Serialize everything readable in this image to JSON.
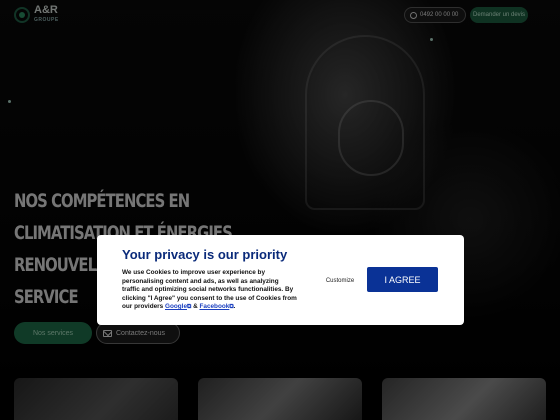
{
  "header": {
    "logo_text": "A&R",
    "logo_subtext": "GROUPE",
    "phone_label": "0492 00 00 00",
    "cta_label": "Demander un devis"
  },
  "hero": {
    "title": "NOS COMPÉTENCES EN CLIMATISATION ET ÉNERGIES RENOUVELABLES À VOTRE SERVICE",
    "primary_button": "Nos services",
    "secondary_button": "Contactez-nous"
  },
  "consent": {
    "title": "Your privacy is our priority",
    "body": "We use Cookies to improve user experience by personalising content and ads, as well as analyzing traffic and optimizing social networks functionalities. By clicking \"I Agree\" you consent to the use of Cookies from our providers",
    "link_google": "Google",
    "link_facebook": "Facebook",
    "and_text": "&",
    "period": ".",
    "customize_label": "Customize",
    "agree_label": "I AGREE"
  },
  "colors": {
    "brand_green": "#1e6b48",
    "consent_title": "#0a2a7a",
    "agree_button": "#0a3296"
  },
  "icons": [
    "logo-mark-icon",
    "phone-icon",
    "mail-icon",
    "external-link-icon"
  ]
}
